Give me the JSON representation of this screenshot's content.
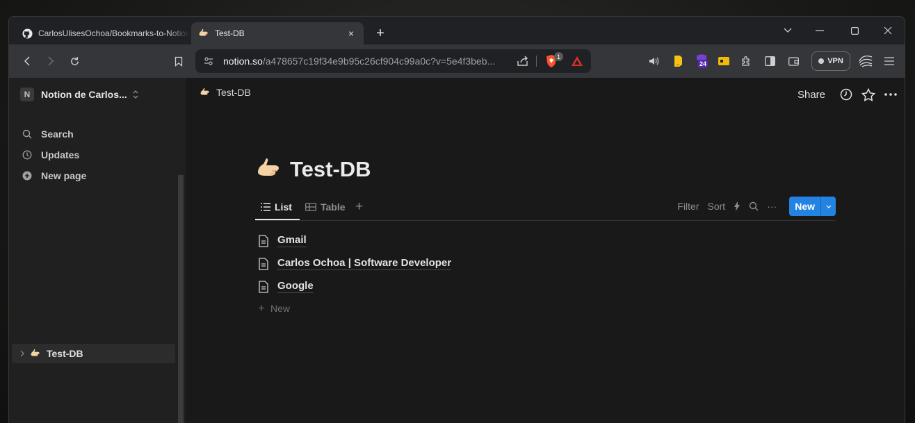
{
  "browser": {
    "tabs": [
      {
        "title": "CarlosUlisesOchoa/Bookmarks-to-Notion",
        "favicon": "github-icon"
      },
      {
        "title": "Test-DB",
        "favicon": "call-me-hand-icon"
      }
    ],
    "tab_close": "×",
    "new_tab": "+",
    "window_controls": {
      "dropdown": "⌄",
      "minimize": "—",
      "maximize": "☐",
      "close": "✕"
    },
    "address": {
      "host": "notion.so",
      "path": "/a478657c19f34e9b95c26cf904c99a0c?v=5e4f3beb..."
    },
    "shields_badge": "1",
    "calendar_ext_date": "24",
    "vpn_label": "VPN",
    "colors": {
      "accent": "#2383e2",
      "shields": "#fb542b",
      "rewards": "#e02f21"
    }
  },
  "sidebar": {
    "workspace_initial": "N",
    "workspace_name": "Notion de Carlos...",
    "items": [
      {
        "label": "Search",
        "icon": "search-icon"
      },
      {
        "label": "Updates",
        "icon": "clock-icon"
      },
      {
        "label": "New page",
        "icon": "plus-circle-icon"
      }
    ],
    "pages": [
      {
        "label": "Test-DB",
        "icon": "call-me-hand-icon"
      }
    ]
  },
  "topbar": {
    "breadcrumb": "Test-DB",
    "share_label": "Share"
  },
  "page": {
    "title": "Test-DB",
    "views": [
      {
        "label": "List",
        "icon": "list-icon",
        "active": true
      },
      {
        "label": "Table",
        "icon": "table-icon",
        "active": false
      }
    ],
    "add_view": "+",
    "tools": {
      "filter": "Filter",
      "sort": "Sort",
      "more": "···"
    },
    "new_button": "New",
    "rows": [
      "Gmail",
      "Carlos Ochoa | Software Developer",
      "Google"
    ],
    "add_new_label": "New"
  }
}
